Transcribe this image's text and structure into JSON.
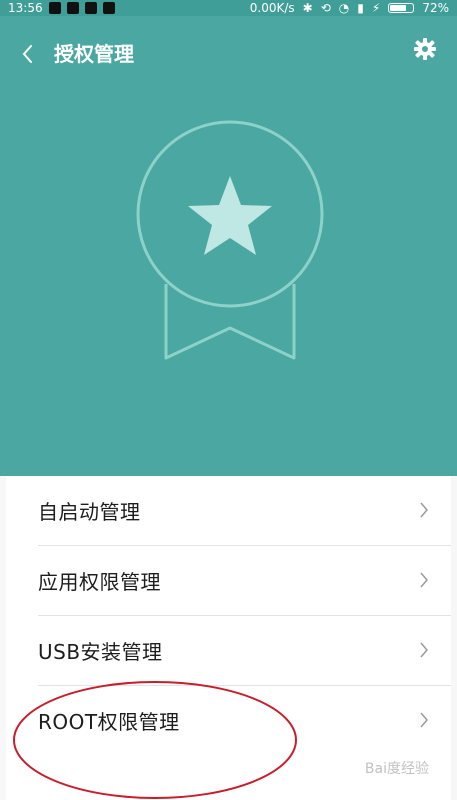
{
  "status_bar": {
    "time": "13:56",
    "network_speed": "0.00K/s",
    "battery": "72%",
    "battery_level": 0.72
  },
  "header": {
    "title": "授权管理"
  },
  "icons": {
    "back": "back-chevron-icon",
    "settings": "gear-icon",
    "badge": "star-ribbon-badge-icon",
    "item_chevron": "chevron-right-icon"
  },
  "colors": {
    "header_bg": "#4aa7a1",
    "badge_line": "#8dd1cb",
    "star": "#bfe7e4",
    "annotation": "#c81d2b",
    "list_bg": "#ffffff"
  },
  "menu": {
    "items": [
      {
        "label": "自启动管理"
      },
      {
        "label": "应用权限管理"
      },
      {
        "label": "USB安装管理"
      },
      {
        "label": "ROOT权限管理"
      }
    ]
  },
  "watermark": "Bai度经验"
}
